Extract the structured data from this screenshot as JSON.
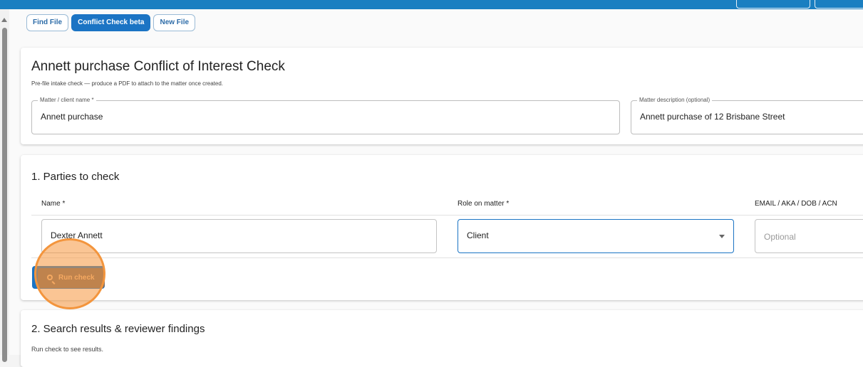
{
  "tabs": [
    {
      "label": "Find File"
    },
    {
      "label": "Conflict Check beta"
    },
    {
      "label": "New File"
    }
  ],
  "header": {
    "title": "Annett purchase Conflict of Interest Check",
    "subtitle": "Pre-file intake check — produce a PDF to attach to the matter once created."
  },
  "matter": {
    "client_label": "Matter / client name *",
    "client_value": "Annett purchase",
    "description_label": "Matter description (optional)",
    "description_value": "Annett purchase of 12 Brisbane Street"
  },
  "parties": {
    "title": "1. Parties to check",
    "columns": {
      "name": "Name *",
      "role": "Role on matter *",
      "email": "EMAIL / AKA / DOB / ACN"
    },
    "rows": [
      {
        "name": "Dexter Annett",
        "role": "Client",
        "email_placeholder": "Optional"
      }
    ],
    "run_check_label": "Run check"
  },
  "results": {
    "title": "2. Search results & reviewer findings",
    "empty_message": "Run check to see results."
  },
  "colors": {
    "topbar": "#1a7fc1",
    "accent": "#1b74c4",
    "highlight": "#f3953d"
  }
}
